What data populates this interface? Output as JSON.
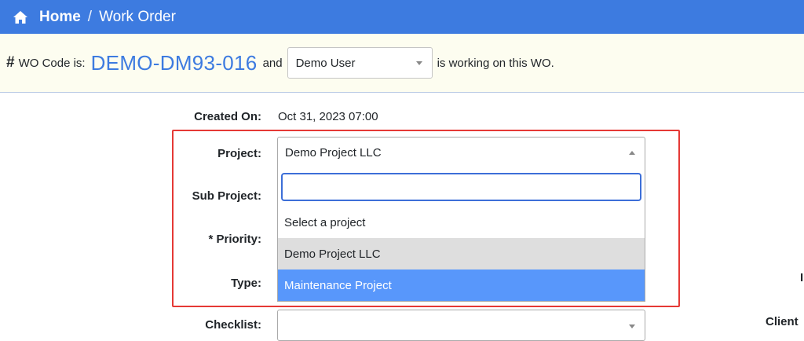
{
  "breadcrumb": {
    "home": "Home",
    "separator": "/",
    "current": "Work Order"
  },
  "info": {
    "prefix": "WO Code is:",
    "code": "DEMO-DM93-016",
    "and": "and",
    "user": "Demo User",
    "suffix": "is working on this WO."
  },
  "form": {
    "created_on_label": "Created On:",
    "created_on_value": "Oct 31, 2023 07:00",
    "project_label": "Project:",
    "project_value": "Demo Project LLC",
    "sub_project_label": "Sub Project:",
    "priority_label": "* Priority:",
    "type_label": "Type:",
    "checklist_label": "Checklist:"
  },
  "dropdown": {
    "search_value": "",
    "options": [
      "Select a project",
      "Demo Project LLC",
      "Maintenance Project"
    ]
  },
  "right_edge": {
    "label_1": "I",
    "label_2": "Client"
  },
  "colors": {
    "topbar": "#3d7be0",
    "accent": "#3d7be0",
    "highlight": "#e53935",
    "active_option": "#5897fb"
  }
}
